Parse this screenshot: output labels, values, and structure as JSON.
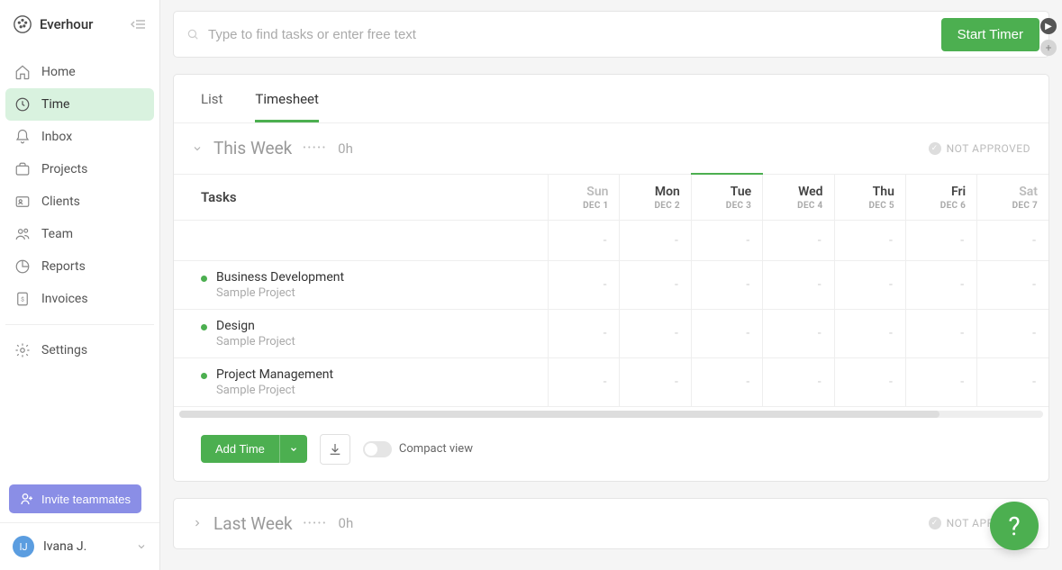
{
  "brand": {
    "name": "Everhour"
  },
  "sidebar": {
    "items": [
      {
        "label": "Home"
      },
      {
        "label": "Time"
      },
      {
        "label": "Inbox"
      },
      {
        "label": "Projects"
      },
      {
        "label": "Clients"
      },
      {
        "label": "Team"
      },
      {
        "label": "Reports"
      },
      {
        "label": "Invoices"
      }
    ],
    "settings_label": "Settings",
    "invite_label": "Invite teammates"
  },
  "user": {
    "initials": "IJ",
    "name": "Ivana J."
  },
  "search": {
    "placeholder": "Type to find tasks or enter free text"
  },
  "start_timer_label": "Start Timer",
  "tabs": {
    "list": "List",
    "timesheet": "Timesheet"
  },
  "weeks": [
    {
      "title": "This Week",
      "hours": "0h",
      "approval": "NOT APPROVED",
      "expanded": true,
      "days": [
        {
          "name": "Sun",
          "date": "DEC 1",
          "muted": true
        },
        {
          "name": "Mon",
          "date": "DEC 2"
        },
        {
          "name": "Tue",
          "date": "DEC 3",
          "today": true
        },
        {
          "name": "Wed",
          "date": "DEC 4"
        },
        {
          "name": "Thu",
          "date": "DEC 5"
        },
        {
          "name": "Fri",
          "date": "DEC 6"
        },
        {
          "name": "Sat",
          "date": "DEC 7",
          "muted": true
        }
      ],
      "tasks_header": "Tasks",
      "tasks": [
        {
          "name": "Business Development",
          "project": "Sample Project",
          "cells": [
            "-",
            "-",
            "-",
            "-",
            "-",
            "-",
            "-"
          ]
        },
        {
          "name": "Design",
          "project": "Sample Project",
          "cells": [
            "-",
            "-",
            "-",
            "-",
            "-",
            "-",
            "-"
          ]
        },
        {
          "name": "Project Management",
          "project": "Sample Project",
          "cells": [
            "-",
            "-",
            "-",
            "-",
            "-",
            "-",
            "-"
          ]
        }
      ],
      "empty_row_cells": [
        "-",
        "-",
        "-",
        "-",
        "-",
        "-",
        "-"
      ]
    },
    {
      "title": "Last Week",
      "hours": "0h",
      "approval": "NOT APPROVED",
      "expanded": false
    }
  ],
  "actions": {
    "add_time": "Add Time",
    "compact_view": "Compact view"
  }
}
